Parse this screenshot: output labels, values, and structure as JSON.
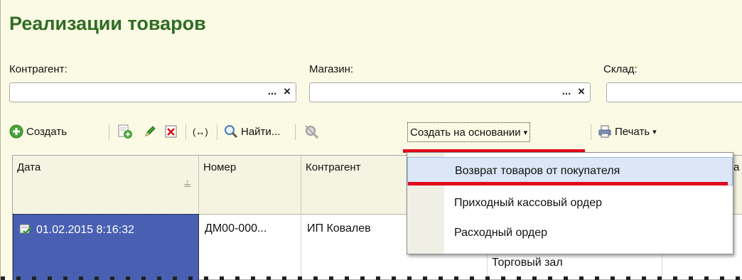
{
  "form": {
    "title": "Реализации товаров"
  },
  "filters": [
    {
      "label": "Контрагент:",
      "value": ""
    },
    {
      "label": "Магазин:",
      "value": ""
    },
    {
      "label": "Склад:",
      "value": ""
    }
  ],
  "field_buttons": {
    "choose": "...",
    "clear": "×"
  },
  "toolbar": {
    "create": "Создать",
    "find": "Найти...",
    "create_based_on": "Создать на основании",
    "print": "Печать",
    "dropdown_arrow": "▾",
    "resize_symbol": "(↔)"
  },
  "table": {
    "columns": [
      "Дата",
      "Номер",
      "Контрагент"
    ],
    "sort_indicator": "≟",
    "rows": [
      {
        "date": "01.02.2015 8:16:32",
        "number": "ДМ00-000...",
        "counterparty": "ИП Ковалев",
        "warehouse": "Торговый зал"
      }
    ],
    "truncated_header_suffix": "а"
  },
  "dropdown": {
    "items": [
      {
        "label": "Возврат товаров от покупателя"
      },
      {
        "label": "Приходный кассовый ордер"
      },
      {
        "label": "Расходный ордер"
      }
    ]
  },
  "colors": {
    "title": "#2f6d24",
    "form_background": "#fbfae4",
    "selection": "#4960b2",
    "highlight_underline": "#e0071b",
    "menu_highlight": "#dbe6f6"
  }
}
